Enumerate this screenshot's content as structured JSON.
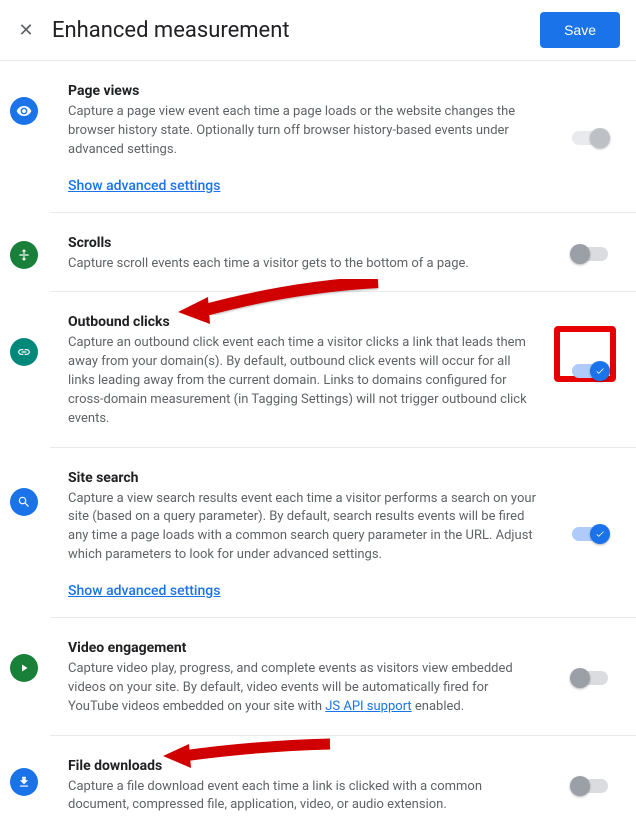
{
  "header": {
    "title": "Enhanced measurement",
    "save_label": "Save"
  },
  "sections": {
    "page_views": {
      "title": "Page views",
      "desc": "Capture a page view event each time a page loads or the website changes the browser history state. Optionally turn off browser history-based events under advanced settings.",
      "advanced": "Show advanced settings"
    },
    "scrolls": {
      "title": "Scrolls",
      "desc": "Capture scroll events each time a visitor gets to the bottom of a page."
    },
    "outbound": {
      "title": "Outbound clicks",
      "desc": "Capture an outbound click event each time a visitor clicks a link that leads them away from your domain(s). By default, outbound click events will occur for all links leading away from the current domain. Links to domains configured for cross-domain measurement (in Tagging Settings) will not trigger outbound click events."
    },
    "site_search": {
      "title": "Site search",
      "desc": "Capture a view search results event each time a visitor performs a search on your site (based on a query parameter). By default, search results events will be fired any time a page loads with a common search query parameter in the URL. Adjust which parameters to look for under advanced settings.",
      "advanced": "Show advanced settings"
    },
    "video": {
      "title": "Video engagement",
      "desc_before": "Capture video play, progress, and complete events as visitors view embedded videos on your site. By default, video events will be automatically fired for YouTube videos embedded on your site with ",
      "link": "JS API support",
      "desc_after": " enabled."
    },
    "downloads": {
      "title": "File downloads",
      "desc": "Capture a file download event each time a link is clicked with a common document, compressed file, application, video, or audio extension."
    }
  }
}
